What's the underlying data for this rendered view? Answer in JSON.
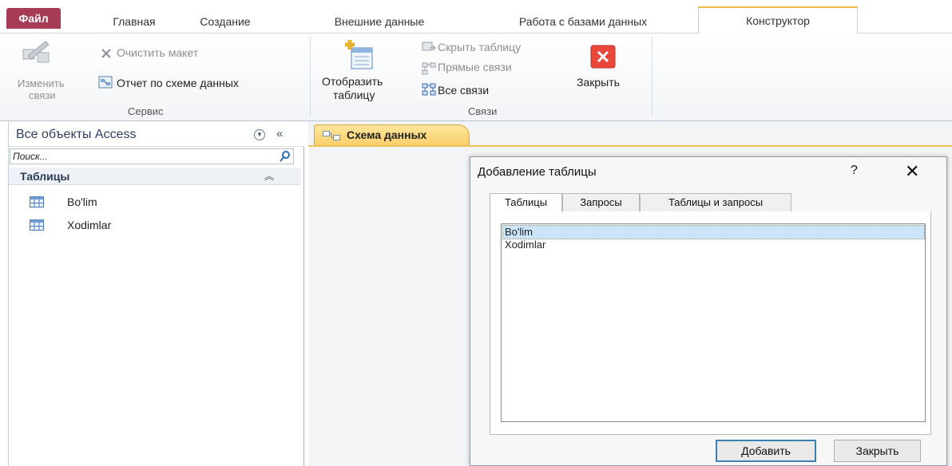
{
  "ribbon_tabs": {
    "file": "Файл",
    "home": "Главная",
    "create": "Создание",
    "external": "Внешние данные",
    "database_tools": "Работа с базами данных",
    "design": "Конструктор"
  },
  "ribbon": {
    "tools_group": {
      "edit_relationships_line1": "Изменить",
      "edit_relationships_line2": "связи",
      "clear_layout": "Очистить макет",
      "relationship_report": "Отчет по схеме данных",
      "label": "Сервис"
    },
    "relationships_group": {
      "show_table_line1": "Отобразить",
      "show_table_line2": "таблицу",
      "hide_table": "Скрыть таблицу",
      "direct_relationships": "Прямые связи",
      "all_relationships": "Все связи",
      "close": "Закрыть",
      "label": "Связи"
    }
  },
  "nav_pane": {
    "title": "Все объекты Access",
    "search_placeholder": "Поиск...",
    "group_title": "Таблицы",
    "items": [
      {
        "label": "Bo'lim"
      },
      {
        "label": "Xodimlar"
      }
    ]
  },
  "document": {
    "tab_label": "Схема данных"
  },
  "dialog": {
    "title": "Добавление таблицы",
    "help": "?",
    "close_glyph": "✕",
    "tabs": [
      "Таблицы",
      "Запросы",
      "Таблицы и запросы"
    ],
    "active_tab": "Таблицы",
    "list": [
      {
        "label": "Bo'lim",
        "selected": true
      },
      {
        "label": "Xodimlar",
        "selected": false
      }
    ],
    "add_button": "Добавить",
    "close_button": "Закрыть"
  },
  "colors": {
    "file_tab": "#a53b55",
    "accent_gold": "#f0b84a",
    "selection": "#cce4f7"
  }
}
